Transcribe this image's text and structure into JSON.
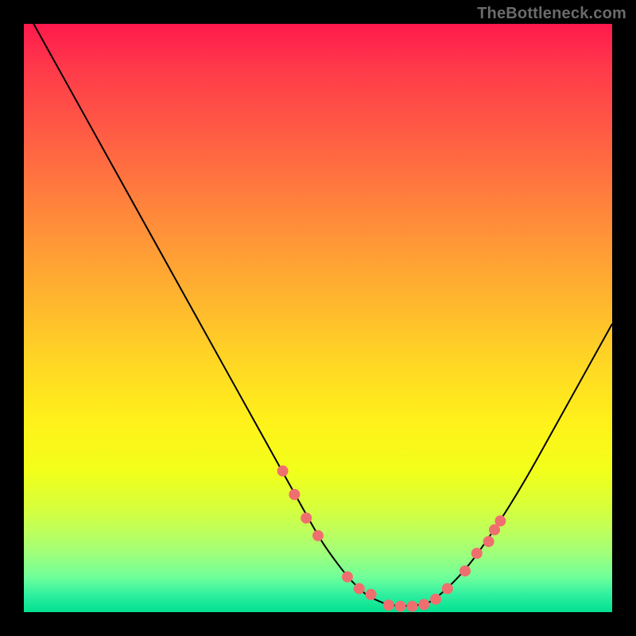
{
  "watermark": "TheBottleneck.com",
  "colors": {
    "background": "#000000",
    "curve": "#000000",
    "markers": "#ef6f6f",
    "gradient_top": "#ff1a4d",
    "gradient_bottom": "#00e090"
  },
  "chart_data": {
    "type": "line",
    "title": "",
    "xlabel": "",
    "ylabel": "",
    "xlim": [
      0,
      100
    ],
    "ylim": [
      0,
      100
    ],
    "grid": false,
    "legend": false,
    "series": [
      {
        "name": "bottleneck-curve",
        "x": [
          0,
          5,
          10,
          15,
          20,
          25,
          30,
          35,
          40,
          45,
          50,
          52,
          55,
          58,
          60,
          62,
          65,
          68,
          70,
          75,
          80,
          85,
          90,
          95,
          100
        ],
        "y": [
          103,
          94,
          85,
          76,
          67,
          58,
          49,
          40,
          31,
          22,
          13,
          10,
          6,
          3,
          2,
          1.2,
          1,
          1.3,
          2.2,
          7,
          14,
          22,
          31,
          40,
          49
        ]
      }
    ],
    "markers": {
      "name": "highlight-points",
      "x": [
        44,
        46,
        48,
        50,
        55,
        57,
        59,
        62,
        64,
        66,
        68,
        70,
        72,
        75,
        77,
        79,
        80,
        81
      ],
      "y": [
        24,
        20,
        16,
        13,
        6,
        4,
        3,
        1.2,
        1,
        1,
        1.3,
        2.2,
        4,
        7,
        10,
        12,
        14,
        15.5
      ]
    }
  }
}
